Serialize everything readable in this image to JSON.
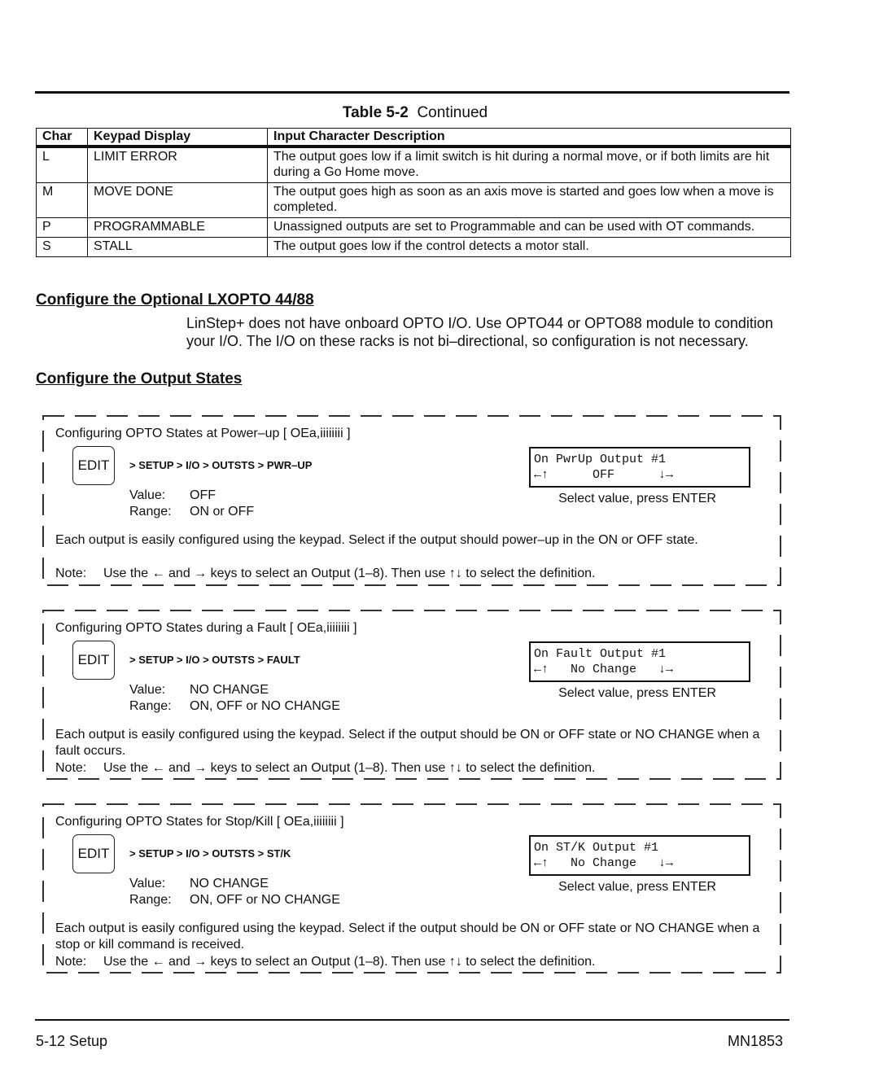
{
  "table": {
    "title_bold": "Table 5-2",
    "title_rest": "Continued",
    "headers": [
      "Char",
      "Keypad Display",
      "Input Character Description"
    ],
    "rows": [
      {
        "char": "L",
        "keypad": "LIMIT ERROR",
        "description": "The output goes low if a limit switch is hit during a normal move, or if both limits are hit during a Go Home move."
      },
      {
        "char": "M",
        "keypad": "MOVE DONE",
        "description": "The output goes high as soon as an axis move is started and goes low when a move is completed."
      },
      {
        "char": "P",
        "keypad": "PROGRAMMABLE",
        "description": "Unassigned outputs are set to Programmable and can be used with OT commands."
      },
      {
        "char": "S",
        "keypad": "STALL",
        "description": "The output goes low if the control detects a motor stall."
      }
    ]
  },
  "section1": {
    "heading": "Configure the Optional LXOPTO 44/88",
    "body": "LinStep+ does not have onboard OPTO I/O. Use OPTO44 or OPTO88 module to condition your I/O. The I/O on these racks is not bi–directional, so configuration is not necessary."
  },
  "section2": {
    "heading": "Configure the Output States"
  },
  "boxes": [
    {
      "title": "Configuring OPTO States at Power–up  [ OEa,iiiiiiii ]",
      "edit_key": "EDIT",
      "menu_path": "> SETUP > I/O > OUTSTS > PWR–UP",
      "value_label": "Value:",
      "value": "OFF",
      "range_label": "Range:",
      "range": "ON or OFF",
      "lcd_line1": "On PwrUp Output #1",
      "lcd_line2": "←↑      OFF      ↓→",
      "lcd_caption": "Select value, press ENTER",
      "description": "Each output is easily configured using the keypad. Select if the output should power–up in the ON or OFF state.",
      "note_label": "Note:",
      "note": "Use the ← and → keys to select an Output (1–8). Then use ↑↓ to select the definition."
    },
    {
      "title": "Configuring OPTO States during a Fault  [ OEa,iiiiiiii  ]",
      "edit_key": "EDIT",
      "menu_path": "> SETUP > I/O > OUTSTS > FAULT",
      "value_label": "Value:",
      "value": "NO CHANGE",
      "range_label": "Range:",
      "range": "ON, OFF or NO CHANGE",
      "lcd_line1": "On Fault Output #1",
      "lcd_line2": "←↑   No Change   ↓→",
      "lcd_caption": "Select value, press ENTER",
      "description": "Each output is easily configured using the keypad. Select if the output should be ON or OFF state or NO CHANGE when a fault occurs.",
      "note_label": "Note:",
      "note": "Use the ← and → keys to select an Output (1–8). Then use ↑↓ to select the definition."
    },
    {
      "title": "Configuring OPTO States for Stop/Kill  [ OEa,iiiiiiii  ]",
      "edit_key": "EDIT",
      "menu_path": "> SETUP > I/O > OUTSTS > ST/K",
      "value_label": "Value:",
      "value": "NO CHANGE",
      "range_label": "Range:",
      "range": "ON, OFF or NO CHANGE",
      "lcd_line1": "On ST/K Output #1",
      "lcd_line2": "←↑   No Change   ↓→",
      "lcd_caption": "Select value, press ENTER",
      "description": "Each output is easily configured using the keypad. Select if the output should be ON or OFF state or NO CHANGE when a stop or kill command is received.",
      "note_label": "Note:",
      "note": "Use the ← and → keys to select an Output (1–8). Then use ↑↓ to select the definition."
    }
  ],
  "footer": {
    "left": "5-12 Setup",
    "right": "MN1853"
  }
}
